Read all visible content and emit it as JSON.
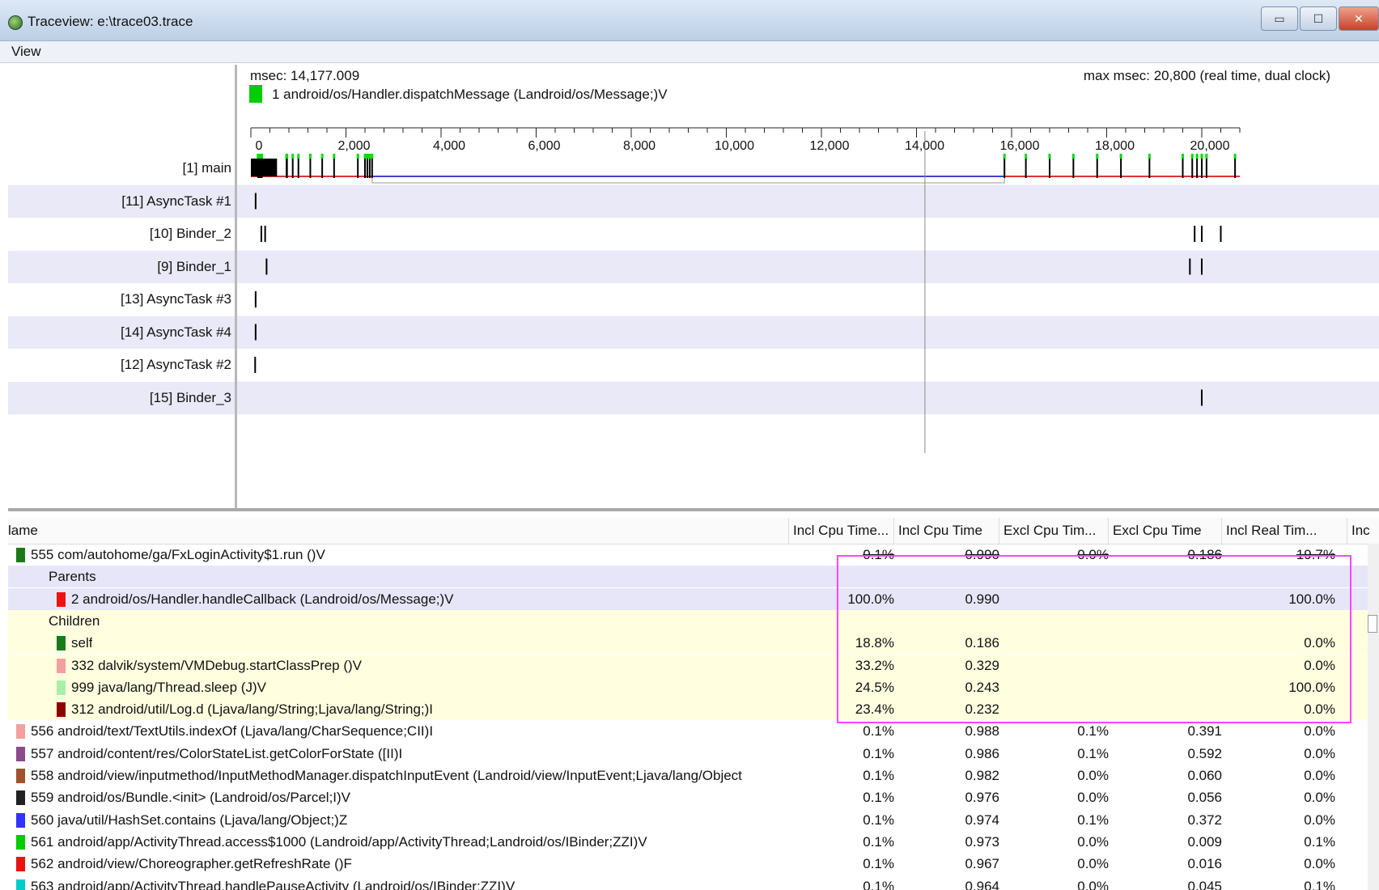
{
  "window": {
    "title": "Traceview: e:\\trace03.trace",
    "controls": {
      "minimize": "▭",
      "maximize": "☐",
      "close": "✕"
    }
  },
  "menu": {
    "view": "View"
  },
  "timeline": {
    "msec": "msec: 14,177.009",
    "max_msec": "max msec: 20,800 (real time, dual clock)",
    "selected_method": "1 android/os/Handler.dispatchMessage (Landroid/os/Message;)V",
    "selected_color": "#00cc00",
    "axis_ticks": [
      "0",
      "2,000",
      "4,000",
      "6,000",
      "8,000",
      "10,000",
      "12,000",
      "14,000",
      "16,000",
      "18,000",
      "20,000"
    ],
    "cursor_value": 14177,
    "max_value": 20800,
    "threads": [
      {
        "label": "[1] main",
        "marks": [
          150,
          170,
          190,
          210,
          230,
          750,
          760,
          880,
          1000,
          1250,
          1500,
          1750,
          2250,
          2400,
          2450,
          2500,
          2550,
          15850,
          16300,
          16800,
          17300,
          17800,
          18300,
          18900,
          19600,
          19800,
          19900,
          20000,
          20100,
          20700
        ]
      },
      {
        "label": "[11] AsyncTask #1",
        "marks": [
          100
        ]
      },
      {
        "label": "[10] Binder_2",
        "marks": [
          220,
          300,
          19850,
          20000,
          20400
        ]
      },
      {
        "label": "[9] Binder_1",
        "marks": [
          330,
          19750,
          20000
        ]
      },
      {
        "label": "[13] AsyncTask #3",
        "marks": [
          100
        ]
      },
      {
        "label": "[14] AsyncTask #4",
        "marks": [
          100
        ]
      },
      {
        "label": "[12] AsyncTask #2",
        "marks": [
          90
        ]
      },
      {
        "label": "[15] Binder_3",
        "marks": [
          20000
        ]
      }
    ]
  },
  "table": {
    "headers": [
      "lame",
      "Incl Cpu Time...",
      "Incl Cpu Time",
      "Excl Cpu Tim...",
      "Excl Cpu Time",
      "Incl Real Tim...",
      "Inc"
    ],
    "rows": [
      {
        "type": "method",
        "indent": 0,
        "color": "#1a7a1a",
        "name": "555 com/autohome/ga/FxLoginActivity$1.run ()V",
        "v": [
          "0.1%",
          "0.990",
          "0.0%",
          "0.186",
          "19.7%"
        ],
        "strike": true
      },
      {
        "type": "parents",
        "indent": 1,
        "label": "Parents"
      },
      {
        "type": "parent",
        "indent": 2,
        "color": "#ee1111",
        "name": "2 android/os/Handler.handleCallback (Landroid/os/Message;)V",
        "v": [
          "100.0%",
          "0.990",
          "",
          "",
          "100.0%"
        ]
      },
      {
        "type": "children",
        "indent": 1,
        "label": "Children"
      },
      {
        "type": "child",
        "indent": 2,
        "color": "#1a7a1a",
        "name": "self",
        "v": [
          "18.8%",
          "0.186",
          "",
          "",
          "0.0%"
        ]
      },
      {
        "type": "child",
        "indent": 2,
        "color": "#f4a0a0",
        "name": "332 dalvik/system/VMDebug.startClassPrep ()V",
        "v": [
          "33.2%",
          "0.329",
          "",
          "",
          "0.0%"
        ]
      },
      {
        "type": "child",
        "indent": 2,
        "color": "#a8f0a8",
        "name": "999 java/lang/Thread.sleep (J)V",
        "v": [
          "24.5%",
          "0.243",
          "",
          "",
          "100.0%"
        ]
      },
      {
        "type": "child",
        "indent": 2,
        "color": "#8b0000",
        "name": "312 android/util/Log.d (Ljava/lang/String;Ljava/lang/String;)I",
        "v": [
          "23.4%",
          "0.232",
          "",
          "",
          "0.0%"
        ]
      },
      {
        "type": "method",
        "indent": 0,
        "color": "#f4a0a0",
        "name": "556 android/text/TextUtils.indexOf (Ljava/lang/CharSequence;CII)I",
        "v": [
          "0.1%",
          "0.988",
          "0.1%",
          "0.391",
          "0.0%"
        ]
      },
      {
        "type": "method",
        "indent": 0,
        "color": "#8b4a8b",
        "name": "557 android/content/res/ColorStateList.getColorForState ([II)I",
        "v": [
          "0.1%",
          "0.986",
          "0.1%",
          "0.592",
          "0.0%"
        ]
      },
      {
        "type": "method",
        "indent": 0,
        "color": "#a0522d",
        "name": "558 android/view/inputmethod/InputMethodManager.dispatchInputEvent (Landroid/view/InputEvent;Ljava/lang/Object",
        "v": [
          "0.1%",
          "0.982",
          "0.0%",
          "0.060",
          "0.0%"
        ]
      },
      {
        "type": "method",
        "indent": 0,
        "color": "#222222",
        "name": "559 android/os/Bundle.<init> (Landroid/os/Parcel;I)V",
        "v": [
          "0.1%",
          "0.976",
          "0.0%",
          "0.056",
          "0.0%"
        ]
      },
      {
        "type": "method",
        "indent": 0,
        "color": "#3333ff",
        "name": "560 java/util/HashSet.contains (Ljava/lang/Object;)Z",
        "v": [
          "0.1%",
          "0.974",
          "0.1%",
          "0.372",
          "0.0%"
        ]
      },
      {
        "type": "method",
        "indent": 0,
        "color": "#00cc00",
        "name": "561 android/app/ActivityThread.access$1000 (Landroid/app/ActivityThread;Landroid/os/IBinder;ZZI)V",
        "v": [
          "0.1%",
          "0.973",
          "0.0%",
          "0.009",
          "0.1%"
        ]
      },
      {
        "type": "method",
        "indent": 0,
        "color": "#ee1111",
        "name": "562 android/view/Choreographer.getRefreshRate ()F",
        "v": [
          "0.1%",
          "0.967",
          "0.0%",
          "0.016",
          "0.0%"
        ]
      },
      {
        "type": "method",
        "indent": 0,
        "color": "#00cccc",
        "name": "563 android/app/ActivityThread.handlePauseActivity (Landroid/os/IBinder;ZZI)V",
        "v": [
          "0.1%",
          "0.964",
          "0.0%",
          "0.045",
          "0.1%"
        ]
      }
    ]
  }
}
